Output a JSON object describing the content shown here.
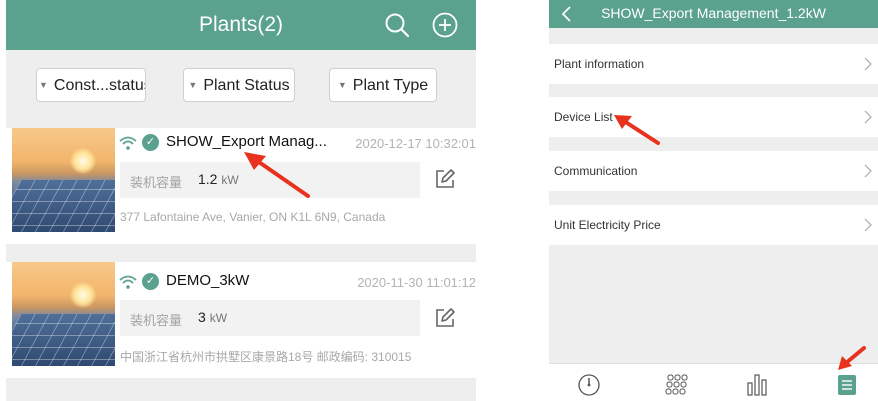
{
  "left_screen": {
    "header": {
      "title": "Plants(2)",
      "search_icon": "search-icon",
      "add_icon": "plus-circle-icon"
    },
    "filters": [
      {
        "label": "Const...status"
      },
      {
        "label": "Plant Status"
      },
      {
        "label": "Plant Type"
      }
    ],
    "plants": [
      {
        "name": "SHOW_Export Manag...",
        "date": "2020-12-17 10:32:01",
        "capacity_label": "装机容量",
        "capacity_value": "1.2",
        "capacity_unit": "kW",
        "address": "377 Lafontaine Ave, Vanier, ON K1L 6N9, Canada"
      },
      {
        "name": "DEMO_3kW",
        "date": "2020-11-30 11:01:12",
        "capacity_label": "装机容量",
        "capacity_value": "3",
        "capacity_unit": "kW",
        "address": "中国浙江省杭州市拱墅区康景路18号 邮政编码: 310015"
      }
    ]
  },
  "right_screen": {
    "header": {
      "title": "SHOW_Export Management_1.2kW",
      "back_icon": "chevron-left-icon"
    },
    "menu": [
      {
        "label": "Plant information"
      },
      {
        "label": "Device List"
      },
      {
        "label": "Communication"
      },
      {
        "label": "Unit Electricity Price"
      }
    ],
    "tabbar_icons": [
      "gauge-icon",
      "grid-icon",
      "bar-chart-icon",
      "list-icon"
    ]
  },
  "colors": {
    "header_green": "#5aa18e",
    "arrow_red": "#e8321e",
    "active_tab_green": "#5aa18e"
  }
}
